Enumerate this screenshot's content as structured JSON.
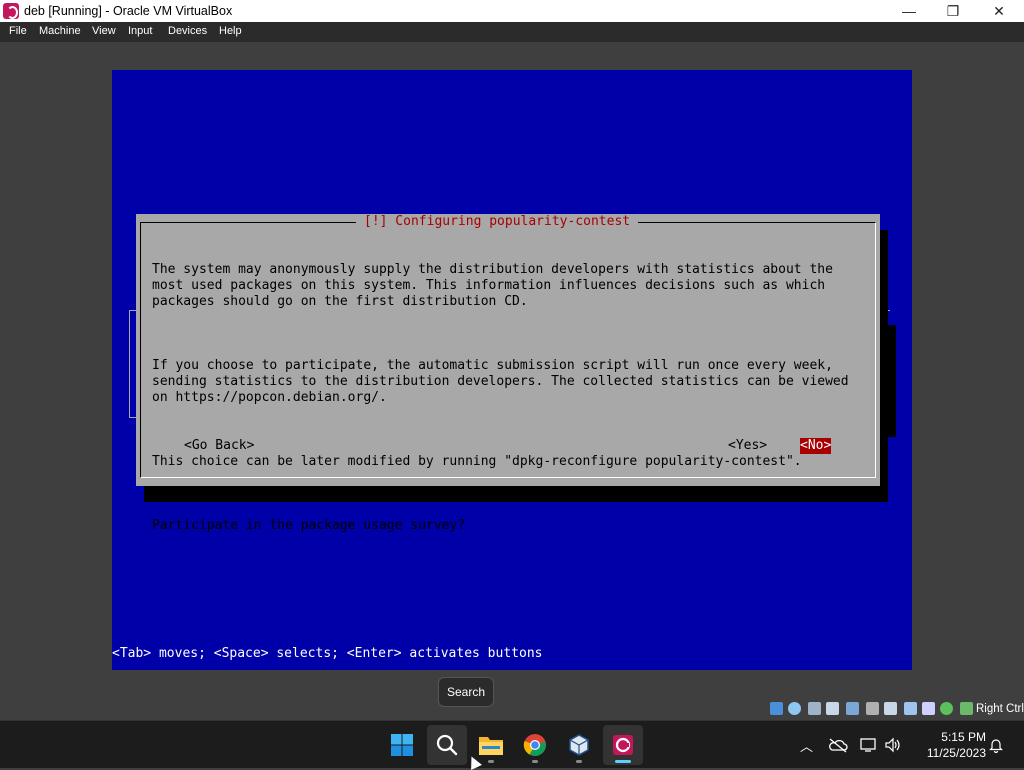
{
  "window": {
    "title": "deb [Running] - Oracle VM VirtualBox",
    "icon": "virtualbox-debian-icon",
    "controls": {
      "minimize": "—",
      "maximize": "❐",
      "close": "✕"
    }
  },
  "menu": {
    "items": [
      {
        "label": "File"
      },
      {
        "label": "Machine"
      },
      {
        "label": "View"
      },
      {
        "label": "Input"
      },
      {
        "label": "Devices"
      },
      {
        "label": "Help"
      }
    ]
  },
  "installer": {
    "title": "[!] Configuring popularity-contest",
    "paragraphs": [
      "The system may anonymously supply the distribution developers with statistics about the\nmost used packages on this system. This information influences decisions such as which\npackages should go on the first distribution CD.",
      "If you choose to participate, the automatic submission script will run once every week,\nsending statistics to the distribution developers. The collected statistics can be viewed\non https://popcon.debian.org/.",
      "This choice can be later modified by running \"dpkg-reconfigure popularity-contest\".",
      "Participate in the package usage survey?"
    ],
    "buttons": {
      "go_back": "<Go Back>",
      "yes": "<Yes>",
      "no": "<No>"
    },
    "selected_button": "no",
    "footer": "<Tab> moves; <Space> selects; <Enter> activates buttons",
    "colors": {
      "screen_bg": "#0000a8",
      "dialog_bg": "#a8a8a8",
      "title_fg": "#a80000",
      "selected_bg": "#a80000"
    }
  },
  "tooltip": {
    "text": "Search"
  },
  "vbox_status": {
    "host_key": "Right Ctrl",
    "icons": [
      "hard-disk-icon",
      "optical-drive-icon",
      "audio-icon",
      "network-icon",
      "usb-icon",
      "shared-folders-icon",
      "display-icon",
      "recording-icon",
      "virtualization-icon",
      "mouse-integration-icon",
      "keyboard-icon"
    ]
  },
  "taskbar": {
    "apps": [
      {
        "name": "start-button",
        "icon": "windows-logo-icon"
      },
      {
        "name": "search-button",
        "icon": "search-icon"
      },
      {
        "name": "file-explorer",
        "icon": "folder-icon"
      },
      {
        "name": "chrome",
        "icon": "chrome-icon"
      },
      {
        "name": "virtualbox",
        "icon": "virtualbox-icon"
      },
      {
        "name": "deb-vm",
        "icon": "debian-vm-icon"
      }
    ],
    "clock": {
      "time": "5:15 PM",
      "date": "11/25/2023"
    }
  }
}
